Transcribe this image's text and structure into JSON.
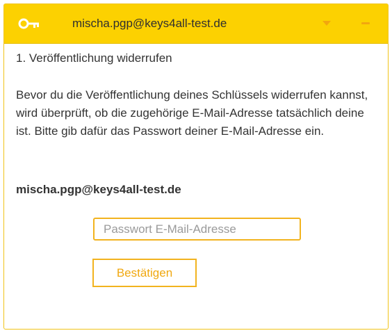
{
  "header": {
    "title": "mischa.pgp@keys4all-test.de",
    "icons": {
      "key": "key-icon",
      "expand": "chevron-down-icon",
      "minimize": "minimize-icon"
    }
  },
  "step": {
    "title": "1. Veröffentlichung widerrufen",
    "description": "Bevor du die Veröffentlichung deines Schlüssels widerrufen kannst, wird überprüft, ob die zugehörige E-Mail-Adresse tatsächlich deine ist. Bitte gib dafür das Passwort deiner E-Mail-Adresse ein.",
    "email": "mischa.pgp@keys4all-test.de"
  },
  "form": {
    "password_placeholder": "Passwort E-Mail-Adresse",
    "password_value": "",
    "confirm_label": "Bestätigen"
  },
  "colors": {
    "header_bg": "#fcd101",
    "accent": "#f2b31e",
    "button_text": "#f0a810"
  }
}
